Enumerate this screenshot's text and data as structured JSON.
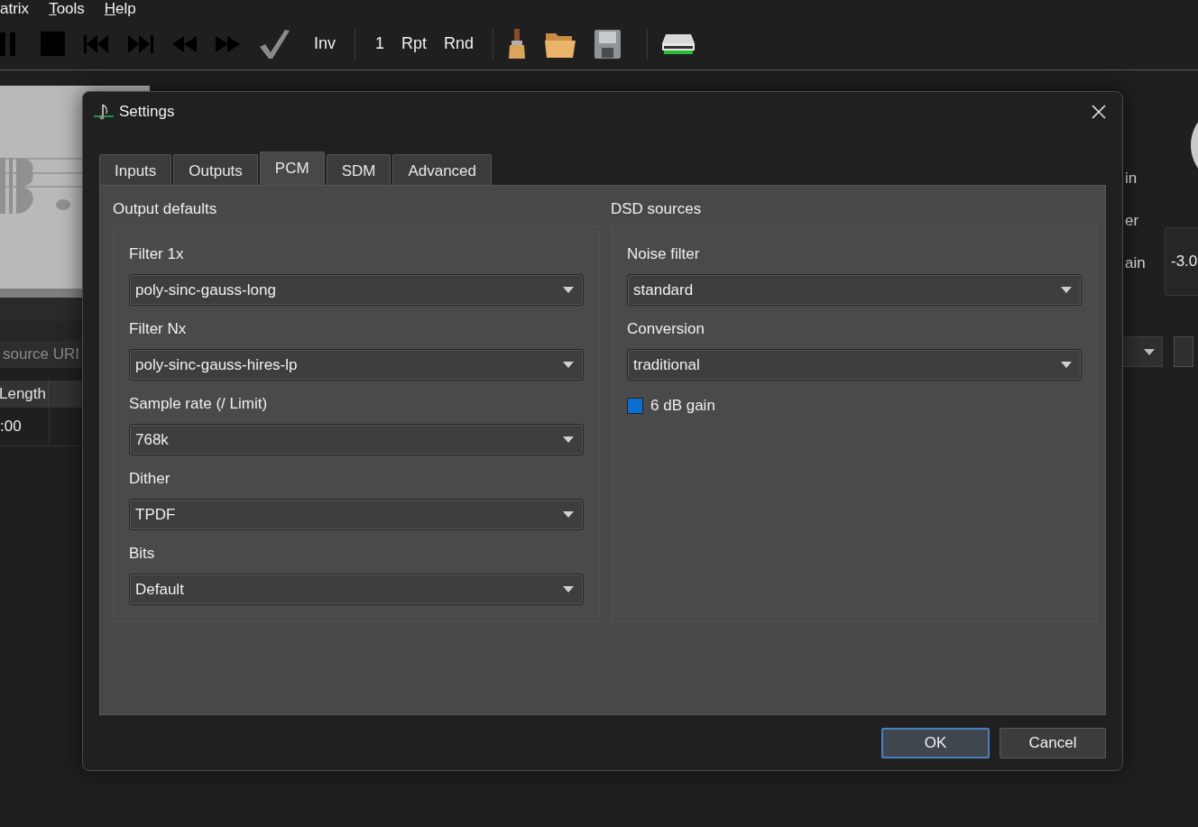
{
  "menu": [
    {
      "label": "atrix",
      "underline_first": false
    },
    {
      "label": "Tools",
      "underline_first": true
    },
    {
      "label": "Help",
      "underline_first": true
    }
  ],
  "toolbar": {
    "text_buttons": [
      "Inv",
      "1",
      "Rpt",
      "Rnd"
    ]
  },
  "source_field": {
    "placeholder": "source URI"
  },
  "table": {
    "columns": [
      "Length"
    ],
    "rows": [
      [
        ":00"
      ]
    ]
  },
  "side_labels": [
    "in",
    "er",
    "ain"
  ],
  "gain_value": "-3.0",
  "dialog": {
    "title": "Settings",
    "tabs": [
      {
        "label": "Inputs",
        "selected": false
      },
      {
        "label": "Outputs",
        "selected": false
      },
      {
        "label": "PCM",
        "selected": true
      },
      {
        "label": "SDM",
        "selected": false
      },
      {
        "label": "Advanced",
        "selected": false
      }
    ],
    "groups": [
      {
        "title": "Output defaults",
        "items": [
          {
            "kind": "combo",
            "label": "Filter 1x",
            "value": "poly-sinc-gauss-long"
          },
          {
            "kind": "combo",
            "label": "Filter Nx",
            "value": "poly-sinc-gauss-hires-lp"
          },
          {
            "kind": "combo",
            "label": "Sample rate (/ Limit)",
            "value": "768k"
          },
          {
            "kind": "combo",
            "label": "Dither",
            "value": "TPDF"
          },
          {
            "kind": "combo",
            "label": "Bits",
            "value": "Default"
          }
        ]
      },
      {
        "title": "DSD sources",
        "items": [
          {
            "kind": "combo",
            "label": "Noise filter",
            "value": "standard"
          },
          {
            "kind": "combo",
            "label": "Conversion",
            "value": "traditional"
          },
          {
            "kind": "checkbox",
            "label": "6 dB gain",
            "checked": true
          }
        ]
      }
    ],
    "buttons": [
      {
        "label": "OK",
        "default": true
      },
      {
        "label": "Cancel",
        "default": false
      }
    ]
  }
}
